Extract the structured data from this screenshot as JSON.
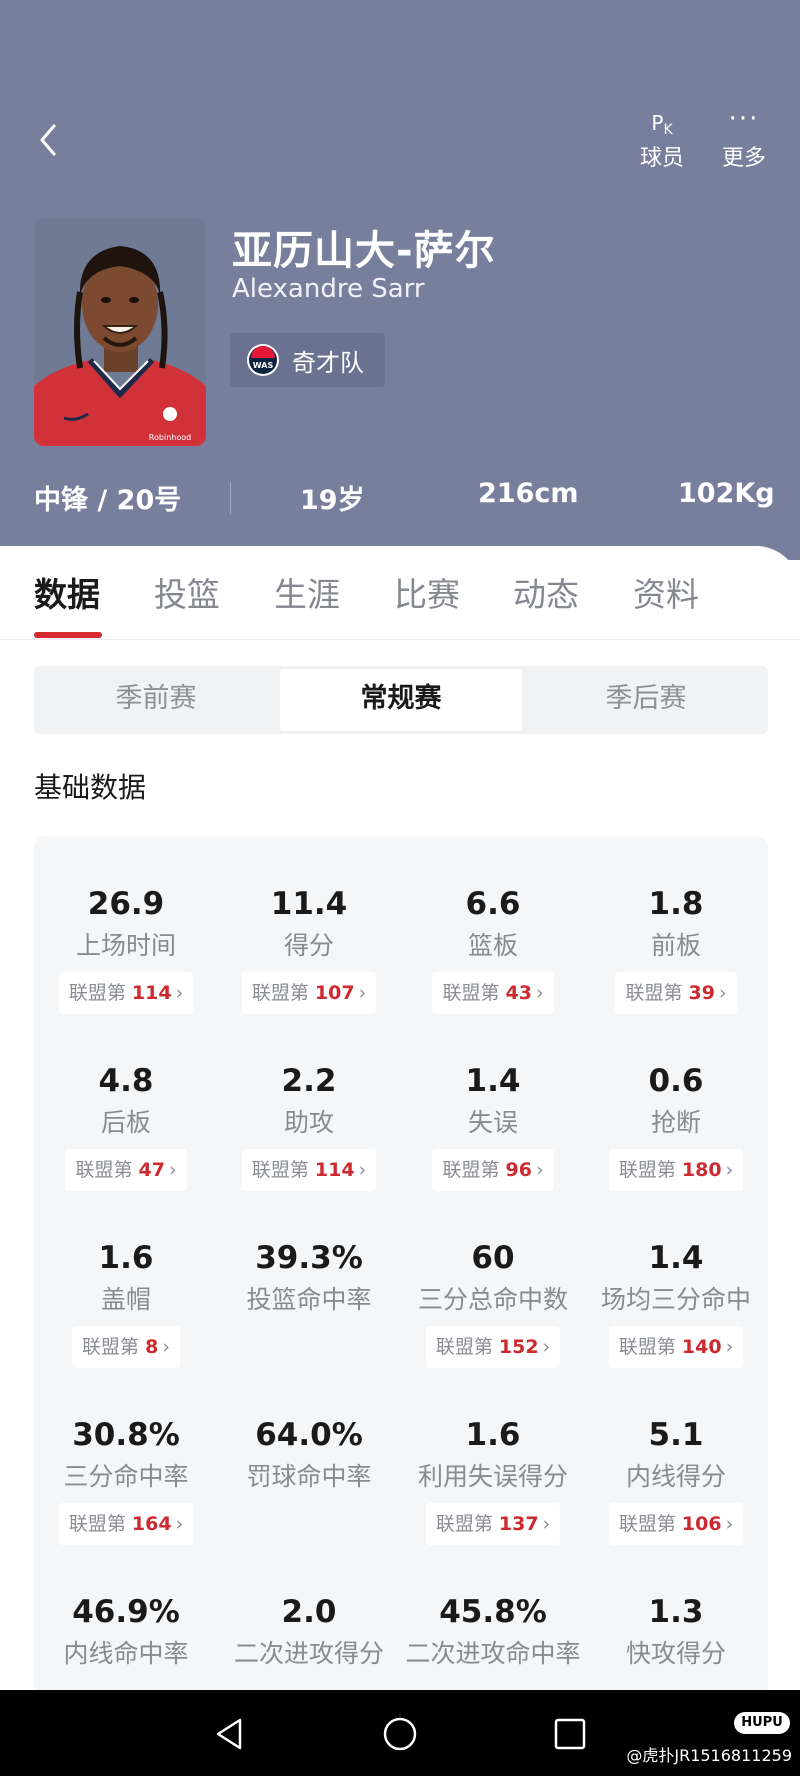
{
  "header": {
    "pk_label": "球员",
    "pk_glyph": "P",
    "pk_glyph_sub": "K",
    "more_label": "更多",
    "more_glyph": "···"
  },
  "player": {
    "name_cn": "亚历山大-萨尔",
    "name_en": "Alexandre Sarr",
    "team": "奇才队",
    "team_logo_text": "WAS",
    "position_number": "中锋 / 20号",
    "age": "19岁",
    "height": "216cm",
    "weight": "102Kg",
    "jersey_sponsor": "Robinhood"
  },
  "colors": {
    "header_bg": "#777f9d",
    "accent": "#d62b2f",
    "rank_red": "#cc2a2f"
  },
  "tabs": [
    {
      "label": "数据",
      "active": true
    },
    {
      "label": "投篮"
    },
    {
      "label": "生涯"
    },
    {
      "label": "比赛"
    },
    {
      "label": "动态"
    },
    {
      "label": "资料"
    }
  ],
  "season_types": [
    {
      "label": "季前赛"
    },
    {
      "label": "常规赛",
      "active": true
    },
    {
      "label": "季后赛"
    }
  ],
  "section_title": "基础数据",
  "rank_prefix": "联盟第",
  "stats": [
    {
      "value": "26.9",
      "label": "上场时间",
      "rank": "114"
    },
    {
      "value": "11.4",
      "label": "得分",
      "rank": "107"
    },
    {
      "value": "6.6",
      "label": "篮板",
      "rank": "43"
    },
    {
      "value": "1.8",
      "label": "前板",
      "rank": "39"
    },
    {
      "value": "4.8",
      "label": "后板",
      "rank": "47"
    },
    {
      "value": "2.2",
      "label": "助攻",
      "rank": "114"
    },
    {
      "value": "1.4",
      "label": "失误",
      "rank": "96"
    },
    {
      "value": "0.6",
      "label": "抢断",
      "rank": "180"
    },
    {
      "value": "1.6",
      "label": "盖帽",
      "rank": "8"
    },
    {
      "value": "39.3%",
      "label": "投篮命中率",
      "rank": null
    },
    {
      "value": "60",
      "label": "三分总命中数",
      "rank": "152"
    },
    {
      "value": "1.4",
      "label": "场均三分命中",
      "rank": "140"
    },
    {
      "value": "30.8%",
      "label": "三分命中率",
      "rank": "164"
    },
    {
      "value": "64.0%",
      "label": "罚球命中率",
      "rank": null
    },
    {
      "value": "1.6",
      "label": "利用失误得分",
      "rank": "137"
    },
    {
      "value": "5.1",
      "label": "内线得分",
      "rank": "106"
    },
    {
      "value": "46.9%",
      "label": "内线命中率",
      "rank": null
    },
    {
      "value": "2.0",
      "label": "二次进攻得分",
      "rank": null
    },
    {
      "value": "45.8%",
      "label": "二次进攻命中率",
      "rank": null
    },
    {
      "value": "1.3",
      "label": "快攻得分",
      "rank": null
    }
  ],
  "navbar": {
    "watermark_logo": "HUPU",
    "watermark_text": "@虎扑JR1516811259"
  }
}
